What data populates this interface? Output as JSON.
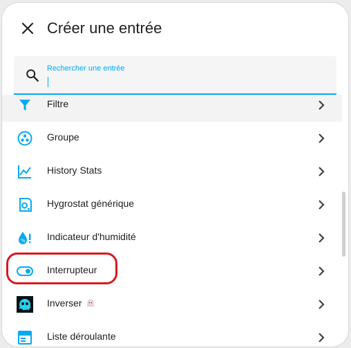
{
  "dialog": {
    "title": "Créer une entrée",
    "close_icon": "close-icon"
  },
  "search": {
    "label": "Rechercher une entrée",
    "value": "",
    "icon": "search-icon"
  },
  "items": [
    {
      "label": "Filtre",
      "icon": "filter-icon"
    },
    {
      "label": "Groupe",
      "icon": "group-icon"
    },
    {
      "label": "History Stats",
      "icon": "chart-line-icon"
    },
    {
      "label": "Hygrostat générique",
      "icon": "hygrostat-icon"
    },
    {
      "label": "Indicateur d'humidité",
      "icon": "humidity-alert-icon"
    },
    {
      "label": "Interrupteur",
      "icon": "toggle-switch-icon"
    },
    {
      "label": "Inverser",
      "icon": "invert-logo-icon"
    },
    {
      "label": "Liste déroulante",
      "icon": "dropdown-list-icon"
    }
  ],
  "colors": {
    "accent": "#03a9f4",
    "highlight_ring": "#d8191f"
  }
}
